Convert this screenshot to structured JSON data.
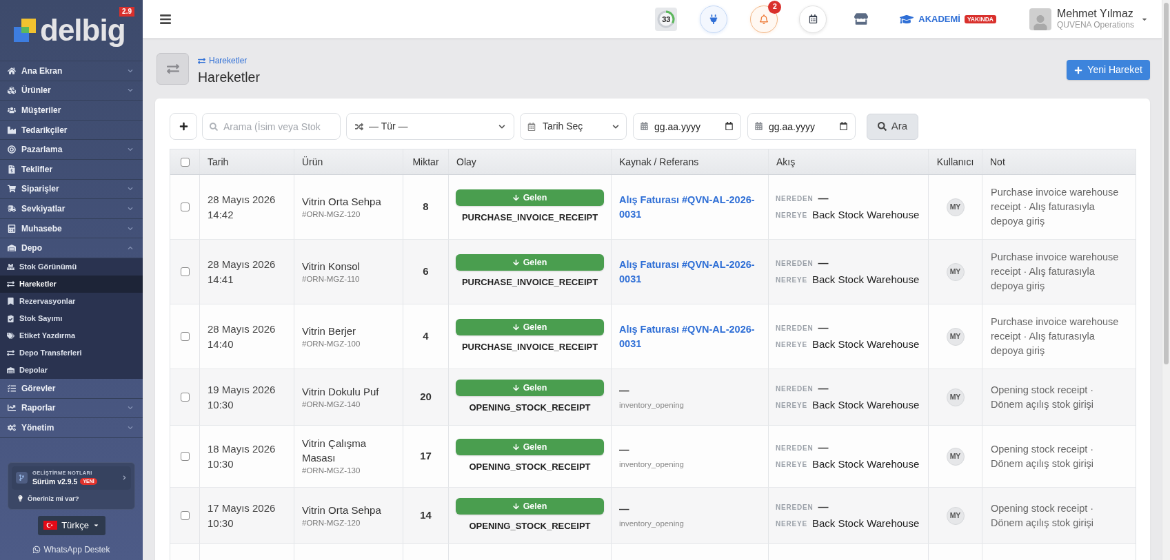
{
  "sidebar": {
    "logo": {
      "text": "delbig",
      "version": "2.9"
    },
    "items": [
      {
        "kind": "group",
        "label": "Ana Ekran",
        "expanded": false
      },
      {
        "kind": "group",
        "label": "Ürünler",
        "expanded": false
      },
      {
        "kind": "link",
        "label": "Müşteriler"
      },
      {
        "kind": "link",
        "label": "Tedarikçiler"
      },
      {
        "kind": "group",
        "label": "Pazarlama",
        "expanded": false
      },
      {
        "kind": "link",
        "label": "Teklifler"
      },
      {
        "kind": "group",
        "label": "Siparişler",
        "expanded": false
      },
      {
        "kind": "group",
        "label": "Sevkiyatlar",
        "expanded": false
      },
      {
        "kind": "group",
        "label": "Muhasebe",
        "expanded": false
      },
      {
        "kind": "group",
        "label": "Depo",
        "expanded": true,
        "children": [
          {
            "label": "Stok Görünümü",
            "selected": false
          },
          {
            "label": "Hareketler",
            "selected": true
          },
          {
            "label": "Rezervasyonlar",
            "selected": false
          },
          {
            "label": "Stok Sayımı",
            "selected": false
          },
          {
            "label": "Etiket Yazdırma",
            "selected": false
          },
          {
            "label": "Depo Transferleri",
            "selected": false
          },
          {
            "label": "Depolar",
            "selected": false
          }
        ]
      },
      {
        "kind": "link",
        "label": "Görevler"
      },
      {
        "kind": "group",
        "label": "Raporlar",
        "expanded": false
      },
      {
        "kind": "group",
        "label": "Yönetim",
        "expanded": false
      }
    ],
    "release_card": {
      "caption": "GELİŞTİRME NOTLARI",
      "version": "Sürüm v2.9.5",
      "badge": "YENİ",
      "suggestion": "Öneriniz mi var?"
    },
    "language": "Türkçe",
    "support": "WhatsApp Destek"
  },
  "topbar": {
    "progress": {
      "value": "33",
      "level": 0.33
    },
    "notifications": {
      "count": "2"
    },
    "academy": {
      "label": "AKADEMİ",
      "badge": "YAKINDA"
    },
    "user": {
      "name": "Mehmet Yılmaz",
      "company": "QUVENA Operations"
    }
  },
  "page": {
    "breadcrumb": "Hareketler",
    "title": "Hareketler",
    "primary_button": "Yeni Hareket"
  },
  "filters": {
    "search": {
      "placeholder": "Arama (İsim veya Stok"
    },
    "type_select": "— Tür —",
    "date_select": "Tarih Seç",
    "date_from": {
      "placeholder": "gg.aa.yyyy"
    },
    "date_to": {
      "placeholder": "gg.aa.yyyy"
    },
    "search_button": "Ara"
  },
  "table": {
    "header_checked": false,
    "columns": [
      "Tarih",
      "Ürün",
      "Miktar",
      "Olay",
      "Kaynak / Referans",
      "Akış",
      "Kullanıcı",
      "Not"
    ],
    "rows": [
      {
        "checked": false,
        "date": "28 Mayıs 2026",
        "time": "14:42",
        "product": "Vitrin Orta Sehpa",
        "sku": "#ORN-MGZ-120",
        "quantity": "8",
        "direction": {
          "kind": "in",
          "label": "Gelen"
        },
        "event": "PURCHASE_INVOICE_RECEIPT",
        "source": {
          "kind": "link",
          "text": "Alış Faturası #QVN-AL-2026-0031"
        },
        "flow": {
          "from_label": "NEREDEN",
          "from": "—",
          "to_label": "NEREYE",
          "to": "Back Stock Warehouse"
        },
        "user": "MY",
        "note": "Purchase invoice warehouse receipt · Alış faturasıyla depoya giriş"
      },
      {
        "checked": false,
        "date": "28 Mayıs 2026",
        "time": "14:41",
        "product": "Vitrin Konsol",
        "sku": "#ORN-MGZ-110",
        "quantity": "6",
        "direction": {
          "kind": "in",
          "label": "Gelen"
        },
        "event": "PURCHASE_INVOICE_RECEIPT",
        "source": {
          "kind": "link",
          "text": "Alış Faturası #QVN-AL-2026-0031"
        },
        "flow": {
          "from_label": "NEREDEN",
          "from": "—",
          "to_label": "NEREYE",
          "to": "Back Stock Warehouse"
        },
        "user": "MY",
        "note": "Purchase invoice warehouse receipt · Alış faturasıyla depoya giriş"
      },
      {
        "checked": false,
        "date": "28 Mayıs 2026",
        "time": "14:40",
        "product": "Vitrin Berjer",
        "sku": "#ORN-MGZ-100",
        "quantity": "4",
        "direction": {
          "kind": "in",
          "label": "Gelen"
        },
        "event": "PURCHASE_INVOICE_RECEIPT",
        "source": {
          "kind": "link",
          "text": "Alış Faturası #QVN-AL-2026-0031"
        },
        "flow": {
          "from_label": "NEREDEN",
          "from": "—",
          "to_label": "NEREYE",
          "to": "Back Stock Warehouse"
        },
        "user": "MY",
        "note": "Purchase invoice warehouse receipt · Alış faturasıyla depoya giriş"
      },
      {
        "checked": false,
        "date": "19 Mayıs 2026",
        "time": "10:30",
        "product": "Vitrin Dokulu Puf",
        "sku": "#ORN-MGZ-140",
        "quantity": "20",
        "direction": {
          "kind": "in",
          "label": "Gelen"
        },
        "event": "OPENING_STOCK_RECEIPT",
        "source": {
          "kind": "plain",
          "text": "—",
          "detail": "inventory_opening"
        },
        "flow": {
          "from_label": "NEREDEN",
          "from": "—",
          "to_label": "NEREYE",
          "to": "Back Stock Warehouse"
        },
        "user": "MY",
        "note": "Opening stock receipt · Dönem açılış stok girişi"
      },
      {
        "checked": false,
        "date": "18 Mayıs 2026",
        "time": "10:30",
        "product": "Vitrin Çalışma Masası",
        "sku": "#ORN-MGZ-130",
        "quantity": "17",
        "direction": {
          "kind": "in",
          "label": "Gelen"
        },
        "event": "OPENING_STOCK_RECEIPT",
        "source": {
          "kind": "plain",
          "text": "—",
          "detail": "inventory_opening"
        },
        "flow": {
          "from_label": "NEREDEN",
          "from": "—",
          "to_label": "NEREYE",
          "to": "Back Stock Warehouse"
        },
        "user": "MY",
        "note": "Opening stock receipt · Dönem açılış stok girişi"
      },
      {
        "checked": false,
        "date": "17 Mayıs 2026",
        "time": "10:30",
        "product": "Vitrin Orta Sehpa",
        "sku": "#ORN-MGZ-120",
        "quantity": "14",
        "direction": {
          "kind": "in",
          "label": "Gelen"
        },
        "event": "OPENING_STOCK_RECEIPT",
        "source": {
          "kind": "plain",
          "text": "—",
          "detail": "inventory_opening"
        },
        "flow": {
          "from_label": "NEREDEN",
          "from": "—",
          "to_label": "NEREYE",
          "to": "Back Stock Warehouse"
        },
        "user": "MY",
        "note": "Opening stock receipt · Dönem açılış stok girişi"
      }
    ]
  }
}
